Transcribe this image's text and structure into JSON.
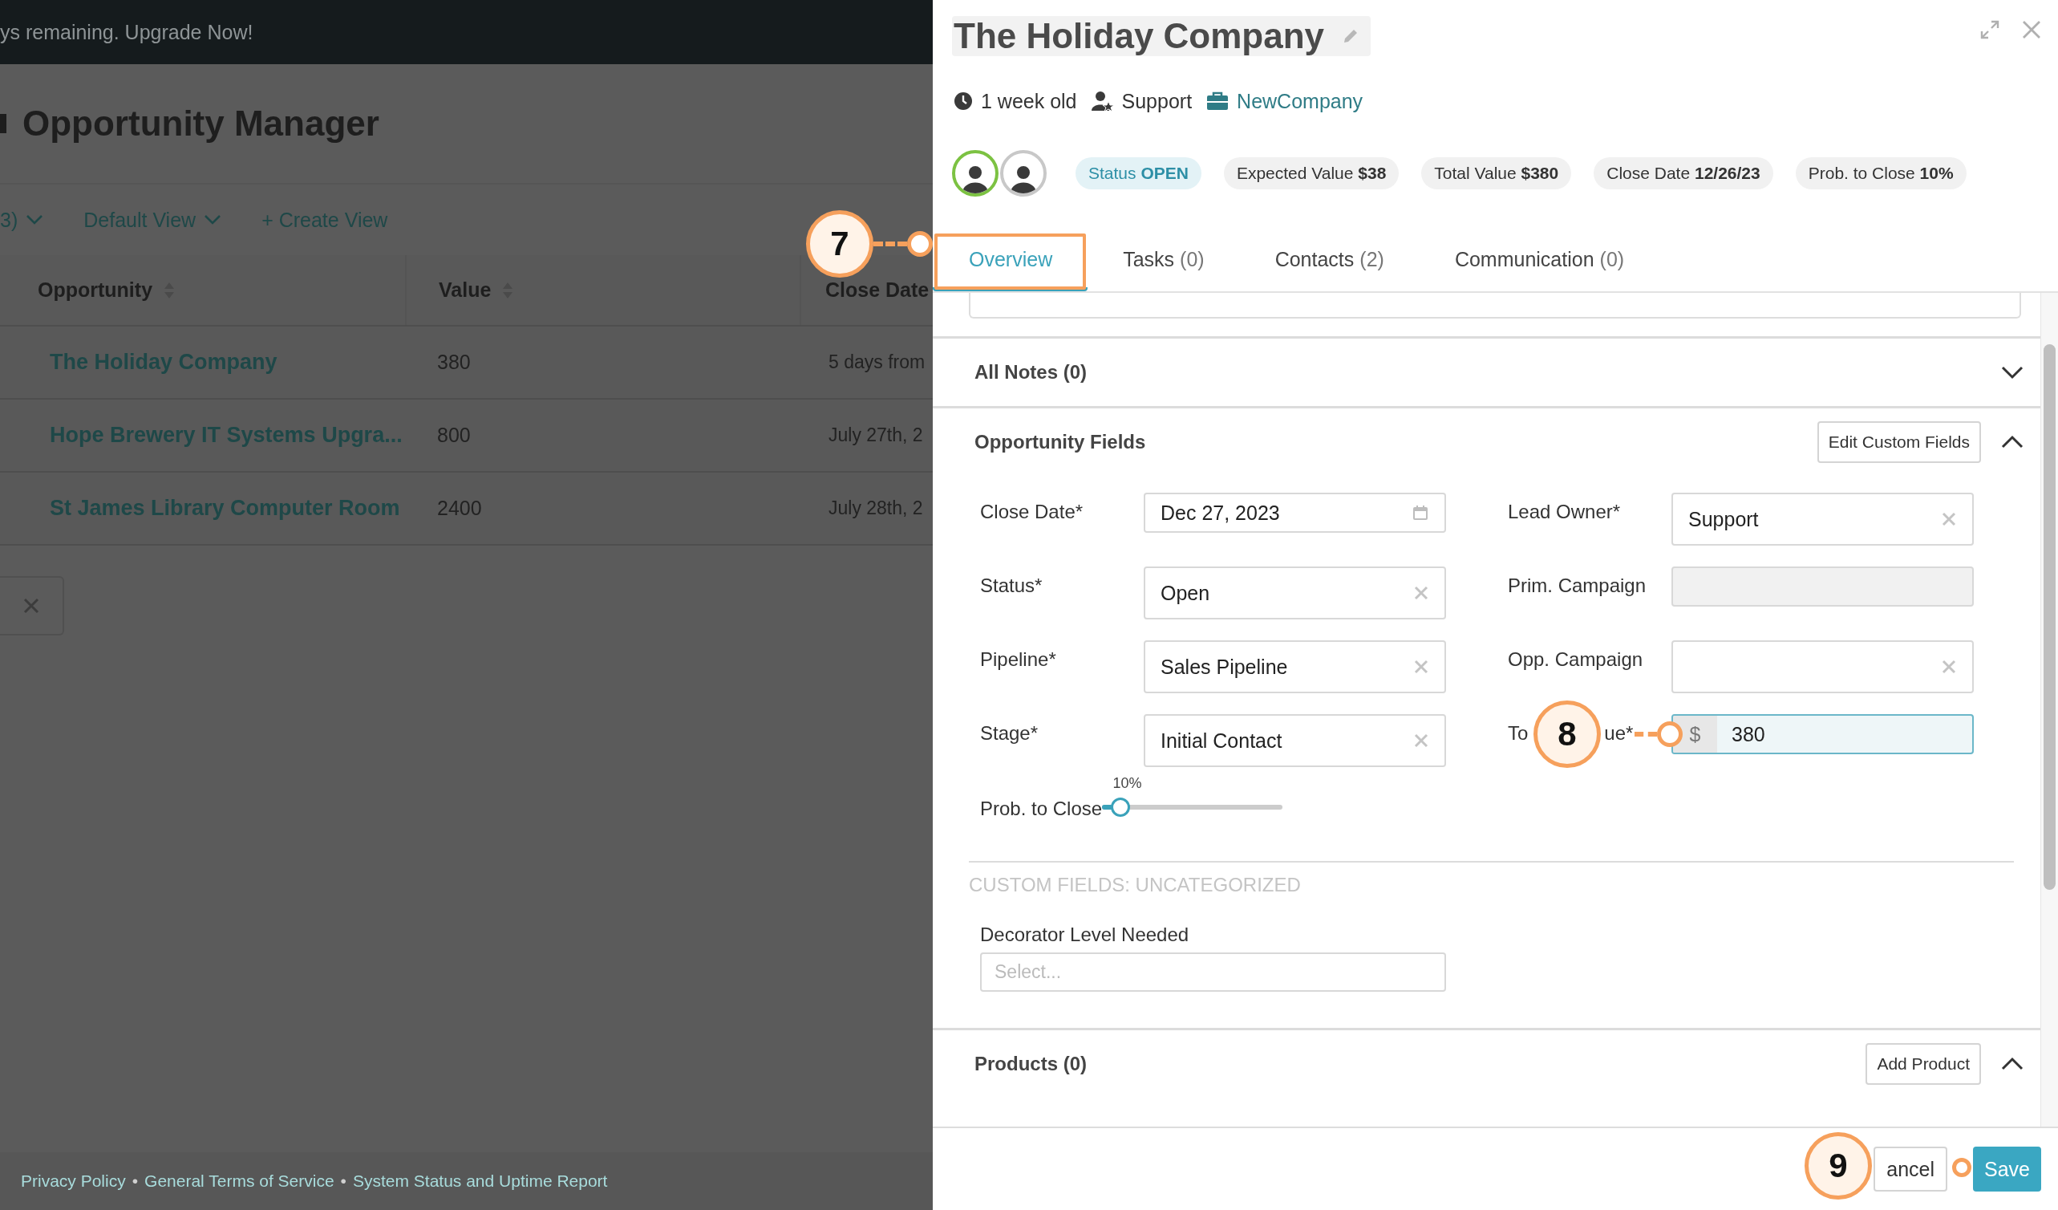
{
  "banner": {
    "text": "ys remaining. Upgrade Now!"
  },
  "page": {
    "title": "Opportunity Manager"
  },
  "toolbar": [
    {
      "label": "3)",
      "kind": "dropdown"
    },
    {
      "label": "Default View",
      "kind": "dropdown"
    },
    {
      "label": "+ Create View",
      "kind": "link"
    }
  ],
  "table": {
    "columns": [
      {
        "label": "Opportunity",
        "kind": "sortable"
      },
      {
        "label": "Value",
        "kind": "sortable"
      },
      {
        "label": "Close Date",
        "kind": "plain"
      }
    ],
    "rows": [
      [
        "The Holiday Company",
        "380",
        "5 days from"
      ],
      [
        "Hope Brewery IT Systems Upgra...",
        "800",
        "July 27th, 2"
      ],
      [
        "St James Library Computer Room",
        "2400",
        "July 28th, 2"
      ]
    ]
  },
  "footer": {
    "links": [
      "Privacy Policy",
      "General Terms of Service",
      "System Status and Uptime Report"
    ],
    "separator": "•"
  },
  "drawer": {
    "title": "The Holiday Company",
    "meta": [
      {
        "kind": "age",
        "text": "1 week old"
      },
      {
        "kind": "owner",
        "text": "Support"
      },
      {
        "kind": "company",
        "text": "NewCompany"
      }
    ],
    "avatars": [
      {
        "selected": true
      },
      {
        "selected": false
      }
    ],
    "pills": [
      {
        "kind": "status",
        "label": "Status",
        "value": "OPEN"
      },
      {
        "kind": "plain",
        "label": "Expected Value",
        "value": "$38"
      },
      {
        "kind": "plain",
        "label": "Total Value",
        "value": "$380"
      },
      {
        "kind": "plain",
        "label": "Close Date",
        "value": "12/26/23"
      },
      {
        "kind": "plain",
        "label": "Prob. to Close",
        "value": "10%"
      }
    ],
    "tabs": [
      {
        "label": "Overview",
        "selected": true
      },
      {
        "label": "Tasks",
        "count": "(0)",
        "selected": false
      },
      {
        "label": "Contacts",
        "count": "(2)",
        "selected": false
      },
      {
        "label": "Communication",
        "count": "(0)",
        "selected": false
      }
    ],
    "notes": {
      "title": "All Notes (0)",
      "expanded": false
    },
    "opportunity_fields": {
      "title": "Opportunity Fields",
      "button": "Edit Custom Fields",
      "expanded": true,
      "left": [
        {
          "kind": "date",
          "label": "Close Date*",
          "value": "Dec 27, 2023"
        },
        {
          "kind": "select",
          "label": "Status*",
          "value": "Open"
        },
        {
          "kind": "select",
          "label": "Pipeline*",
          "value": "Sales Pipeline"
        },
        {
          "kind": "select",
          "label": "Stage*",
          "value": "Initial Contact"
        },
        {
          "kind": "slider",
          "label": "Prob. to Close",
          "level": 0.1,
          "reading": "10%"
        }
      ],
      "right": [
        {
          "kind": "select",
          "label": "Lead Owner*",
          "value": "Support"
        },
        {
          "kind": "disabled",
          "label": "Prim. Campaign"
        },
        {
          "kind": "select",
          "label": "Opp. Campaign"
        },
        {
          "kind": "currency",
          "label": "To",
          "label_end": "ue*",
          "prefix": "$",
          "value": "380",
          "focused": true
        }
      ]
    },
    "custom_fields": {
      "heading": "CUSTOM FIELDS: UNCATEGORIZED",
      "label": "Decorator Level Needed",
      "placeholder": "Select..."
    },
    "products": {
      "title": "Products (0)",
      "button": "Add Product",
      "expanded": true
    },
    "buttons": [
      {
        "kind": "secondary",
        "label": "ancel"
      },
      {
        "kind": "primary",
        "label": "Save"
      }
    ]
  },
  "callouts": [
    {
      "number": "7"
    },
    {
      "number": "8"
    },
    {
      "number": "9"
    }
  ]
}
